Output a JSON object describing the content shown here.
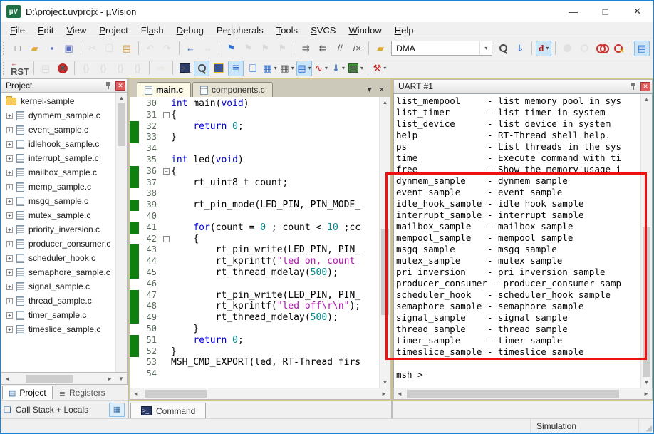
{
  "window": {
    "title": "D:\\project.uvprojx - µVision",
    "controls": {
      "minimize": "—",
      "maximize": "□",
      "close": "✕"
    },
    "app_initials": "µV"
  },
  "colors": {
    "accent": "#1883D7",
    "annotation_red": "#EE1111",
    "exec_green": "#0F7F0F",
    "keyword_blue": "#0000D8",
    "number_teal": "#008A8A",
    "string_magenta": "#B511B5"
  },
  "menu": {
    "items": [
      {
        "label": "File",
        "u": 0
      },
      {
        "label": "Edit",
        "u": 0
      },
      {
        "label": "View",
        "u": 0
      },
      {
        "label": "Project",
        "u": 0
      },
      {
        "label": "Flash",
        "u": 2
      },
      {
        "label": "Debug",
        "u": 0
      },
      {
        "label": "Peripherals",
        "u": 2
      },
      {
        "label": "Tools",
        "u": 0
      },
      {
        "label": "SVCS",
        "u": 0
      },
      {
        "label": "Window",
        "u": 0
      },
      {
        "label": "Help",
        "u": 0
      }
    ]
  },
  "toolbars": {
    "search": {
      "value": "DMA"
    },
    "row1": [
      {
        "t": "b",
        "n": "new-file",
        "g": "□"
      },
      {
        "t": "b",
        "n": "open-file",
        "g": "▰",
        "c": "c-folder"
      },
      {
        "t": "b",
        "n": "save-file",
        "g": "▪",
        "c": "c-save"
      },
      {
        "t": "b",
        "n": "save-all",
        "g": "▣",
        "c": "c-save"
      },
      {
        "t": "s"
      },
      {
        "t": "b",
        "n": "cut",
        "g": "✂",
        "st": "dim"
      },
      {
        "t": "b",
        "n": "copy",
        "g": "❏",
        "st": "dim"
      },
      {
        "t": "b",
        "n": "paste",
        "g": "▤",
        "c": "c-paste"
      },
      {
        "t": "s"
      },
      {
        "t": "b",
        "n": "undo",
        "g": "↶",
        "st": "dim"
      },
      {
        "t": "b",
        "n": "redo",
        "g": "↷",
        "st": "dim"
      },
      {
        "t": "s"
      },
      {
        "t": "b",
        "n": "navigate-back",
        "g": "←",
        "c": "c-blue"
      },
      {
        "t": "b",
        "n": "navigate-forward",
        "g": "→",
        "st": "dim"
      },
      {
        "t": "s"
      },
      {
        "t": "b",
        "n": "bookmark-flag",
        "g": "⚑",
        "c": "c-blue"
      },
      {
        "t": "b",
        "n": "bookmark-next",
        "g": "⚑",
        "st": "dim"
      },
      {
        "t": "b",
        "n": "bookmark-prev",
        "g": "⚑",
        "st": "dim"
      },
      {
        "t": "b",
        "n": "bookmark-clear",
        "g": "⚑",
        "st": "dim"
      },
      {
        "t": "s"
      },
      {
        "t": "b",
        "n": "indent",
        "g": "⇉"
      },
      {
        "t": "b",
        "n": "outdent",
        "g": "⇇"
      },
      {
        "t": "b",
        "n": "comment",
        "g": "//"
      },
      {
        "t": "b",
        "n": "uncomment",
        "g": "/×"
      },
      {
        "t": "s"
      },
      {
        "t": "b",
        "n": "find-files-folder",
        "g": "▰",
        "c": "c-folder"
      },
      {
        "t": "c"
      },
      {
        "t": "b",
        "n": "search-document",
        "c": "i-mag"
      },
      {
        "t": "b",
        "n": "find-next",
        "g": "⇓",
        "c": "c-blue"
      },
      {
        "t": "s"
      },
      {
        "t": "b",
        "n": "quick-find",
        "g": "d",
        "c": "c-qfind",
        "st": "on",
        "d": 1
      },
      {
        "t": "s"
      },
      {
        "t": "b",
        "n": "insert-breakpoint",
        "c": "i-dot",
        "st": "dim"
      },
      {
        "t": "b",
        "n": "enable-breakpoint",
        "c": "i-ring",
        "st": "dim"
      },
      {
        "t": "b",
        "n": "disable-all-breakpoints",
        "c": "i-2ring"
      },
      {
        "t": "b",
        "n": "kill-all-breakpoints",
        "c": "i-dotx"
      },
      {
        "t": "s"
      },
      {
        "t": "b",
        "n": "project-window",
        "g": "▤",
        "c": "c-blue",
        "st": "on"
      }
    ],
    "row2": [
      {
        "t": "b",
        "n": "reset-cpu",
        "g": "RST",
        "c": "i-rst"
      },
      {
        "t": "s"
      },
      {
        "t": "b",
        "n": "show-next-statement",
        "g": "▤",
        "st": "dim"
      },
      {
        "t": "b",
        "n": "stop-debug",
        "c": "i-stop"
      },
      {
        "t": "s"
      },
      {
        "t": "b",
        "n": "step-into",
        "g": "{}",
        "st": "dim"
      },
      {
        "t": "b",
        "n": "step-over",
        "g": "{}",
        "st": "dim"
      },
      {
        "t": "b",
        "n": "step-out",
        "g": "{}",
        "st": "dim"
      },
      {
        "t": "b",
        "n": "run-to-line",
        "g": "{}",
        "st": "dim"
      },
      {
        "t": "s"
      },
      {
        "t": "b",
        "n": "run",
        "g": "⇨",
        "c": "c-run",
        "st": "dim"
      },
      {
        "t": "s"
      },
      {
        "t": "b",
        "n": "command-window",
        "c": "i-term"
      },
      {
        "t": "b",
        "n": "disassembly-window",
        "c": "i-mag",
        "st": "on"
      },
      {
        "t": "b",
        "n": "symbol-window",
        "g": "S",
        "c": "i-s"
      },
      {
        "t": "b",
        "n": "registers-window",
        "g": "≣",
        "c": "c-blue",
        "st": "on"
      },
      {
        "t": "b",
        "n": "callstack-window",
        "g": "❏",
        "c": "c-blue"
      },
      {
        "t": "b",
        "n": "watch-window",
        "g": "▦",
        "c": "c-blue",
        "d": 1
      },
      {
        "t": "b",
        "n": "memory-window",
        "g": "▦",
        "d": 1
      },
      {
        "t": "b",
        "n": "serial-window",
        "g": "▤",
        "c": "i-serial",
        "st": "on",
        "d": 1
      },
      {
        "t": "b",
        "n": "logic-analyzer",
        "g": "∿",
        "c": "c-red",
        "d": 1
      },
      {
        "t": "b",
        "n": "trace-window",
        "g": "⇓",
        "c": "c-blue",
        "d": 1
      },
      {
        "t": "b",
        "n": "system-viewer",
        "g": "▦",
        "c": "i-sys",
        "d": 1
      },
      {
        "t": "s"
      },
      {
        "t": "b",
        "n": "toolbox",
        "g": "⚒",
        "c": "c-red",
        "d": 1
      }
    ]
  },
  "project": {
    "title": "Project",
    "root": "kernel-sample",
    "files": [
      "dynmem_sample.c",
      "event_sample.c",
      "idlehook_sample.c",
      "interrupt_sample.c",
      "mailbox_sample.c",
      "memp_sample.c",
      "msgq_sample.c",
      "mutex_sample.c",
      "priority_inversion.c",
      "producer_consumer.c",
      "scheduler_hook.c",
      "semaphore_sample.c",
      "signal_sample.c",
      "thread_sample.c",
      "timer_sample.c",
      "timeslice_sample.c"
    ]
  },
  "editor": {
    "tabs": [
      {
        "label": "main.c",
        "active": true
      },
      {
        "label": "components.c",
        "active": false
      }
    ],
    "lines": [
      {
        "n": 30,
        "s": [
          [
            "k",
            "int"
          ],
          [
            "p",
            " main("
          ],
          [
            "k",
            "void"
          ],
          [
            "p",
            ")"
          ]
        ]
      },
      {
        "n": 31,
        "f": 1,
        "s": [
          [
            "p",
            "{"
          ]
        ]
      },
      {
        "n": 32,
        "x": 1,
        "s": [
          [
            "p",
            "    "
          ],
          [
            "k",
            "return"
          ],
          [
            "p",
            " "
          ],
          [
            "d",
            "0"
          ],
          [
            "p",
            ";"
          ]
        ]
      },
      {
        "n": 33,
        "x": 1,
        "s": [
          [
            "p",
            "}"
          ]
        ]
      },
      {
        "n": 34,
        "s": []
      },
      {
        "n": 35,
        "s": [
          [
            "k",
            "int"
          ],
          [
            "p",
            " led("
          ],
          [
            "k",
            "void"
          ],
          [
            "p",
            ")"
          ]
        ]
      },
      {
        "n": 36,
        "x": 1,
        "f": 1,
        "s": [
          [
            "p",
            "{"
          ]
        ]
      },
      {
        "n": 37,
        "x": 1,
        "s": [
          [
            "p",
            "    rt_uint8_t count;"
          ]
        ]
      },
      {
        "n": 38,
        "s": []
      },
      {
        "n": 39,
        "x": 1,
        "s": [
          [
            "p",
            "    rt_pin_mode(LED_PIN, PIN_MODE_"
          ]
        ]
      },
      {
        "n": 40,
        "s": []
      },
      {
        "n": 41,
        "x": 1,
        "s": [
          [
            "p",
            "    "
          ],
          [
            "k",
            "for"
          ],
          [
            "p",
            "(count = "
          ],
          [
            "d",
            "0"
          ],
          [
            "p",
            " ; count < "
          ],
          [
            "d",
            "10"
          ],
          [
            "p",
            " ;cc"
          ]
        ]
      },
      {
        "n": 42,
        "f": 1,
        "s": [
          [
            "p",
            "    {"
          ]
        ]
      },
      {
        "n": 43,
        "x": 1,
        "s": [
          [
            "p",
            "        rt_pin_write(LED_PIN, PIN_"
          ]
        ]
      },
      {
        "n": 44,
        "x": 1,
        "s": [
          [
            "p",
            "        rt_kprintf("
          ],
          [
            "t",
            "\"led on, count"
          ]
        ]
      },
      {
        "n": 45,
        "x": 1,
        "s": [
          [
            "p",
            "        rt_thread_mdelay("
          ],
          [
            "d",
            "500"
          ],
          [
            "p",
            ");"
          ]
        ]
      },
      {
        "n": 46,
        "s": []
      },
      {
        "n": 47,
        "x": 1,
        "s": [
          [
            "p",
            "        rt_pin_write(LED_PIN, PIN_"
          ]
        ]
      },
      {
        "n": 48,
        "x": 1,
        "s": [
          [
            "p",
            "        rt_kprintf("
          ],
          [
            "t",
            "\"led off\\r\\n\""
          ],
          [
            "p",
            ");"
          ]
        ]
      },
      {
        "n": 49,
        "x": 1,
        "s": [
          [
            "p",
            "        rt_thread_mdelay("
          ],
          [
            "d",
            "500"
          ],
          [
            "p",
            ");"
          ]
        ]
      },
      {
        "n": 50,
        "s": [
          [
            "p",
            "    }"
          ]
        ]
      },
      {
        "n": 51,
        "x": 1,
        "s": [
          [
            "p",
            "    "
          ],
          [
            "k",
            "return"
          ],
          [
            "p",
            " "
          ],
          [
            "d",
            "0"
          ],
          [
            "p",
            ";"
          ]
        ]
      },
      {
        "n": 52,
        "x": 1,
        "s": [
          [
            "p",
            "}"
          ]
        ]
      },
      {
        "n": 53,
        "s": [
          [
            "p",
            "MSH_CMD_EXPORT(led, RT-Thread firs"
          ]
        ]
      },
      {
        "n": 54,
        "s": []
      }
    ]
  },
  "uart": {
    "title": "UART #1",
    "lines": [
      "list_mempool     - list memory pool in sys",
      "list_timer       - list timer in system",
      "list_device      - list device in system",
      "help             - RT-Thread shell help.",
      "ps               - List threads in the sys",
      "time             - Execute command with ti",
      "free             - Show the memory usage i",
      "dynmem_sample    - dynmem sample",
      "event_sample     - event sample",
      "idle_hook_sample - idle hook sample",
      "interrupt_sample - interrupt sample",
      "mailbox_sample   - mailbox sample",
      "mempool_sample   - mempool sample",
      "msgq_sample      - msgq sample",
      "mutex_sample     - mutex sample",
      "pri_inversion    - pri_inversion sample",
      "producer_consumer - producer_consumer samp",
      "scheduler_hook   - scheduler_hook sample",
      "semaphore_sample - semaphore sample",
      "signal_sample    - signal sample",
      "thread_sample    - thread sample",
      "timer_sample     - timer sample",
      "timeslice_sample - timeslice sample",
      "",
      "msh >"
    ]
  },
  "panels": {
    "project_tab": "Project",
    "registers_tab": "Registers",
    "callstack_label": "Call Stack + Locals",
    "command_label": "Command"
  },
  "statusbar": {
    "mode": "Simulation"
  }
}
